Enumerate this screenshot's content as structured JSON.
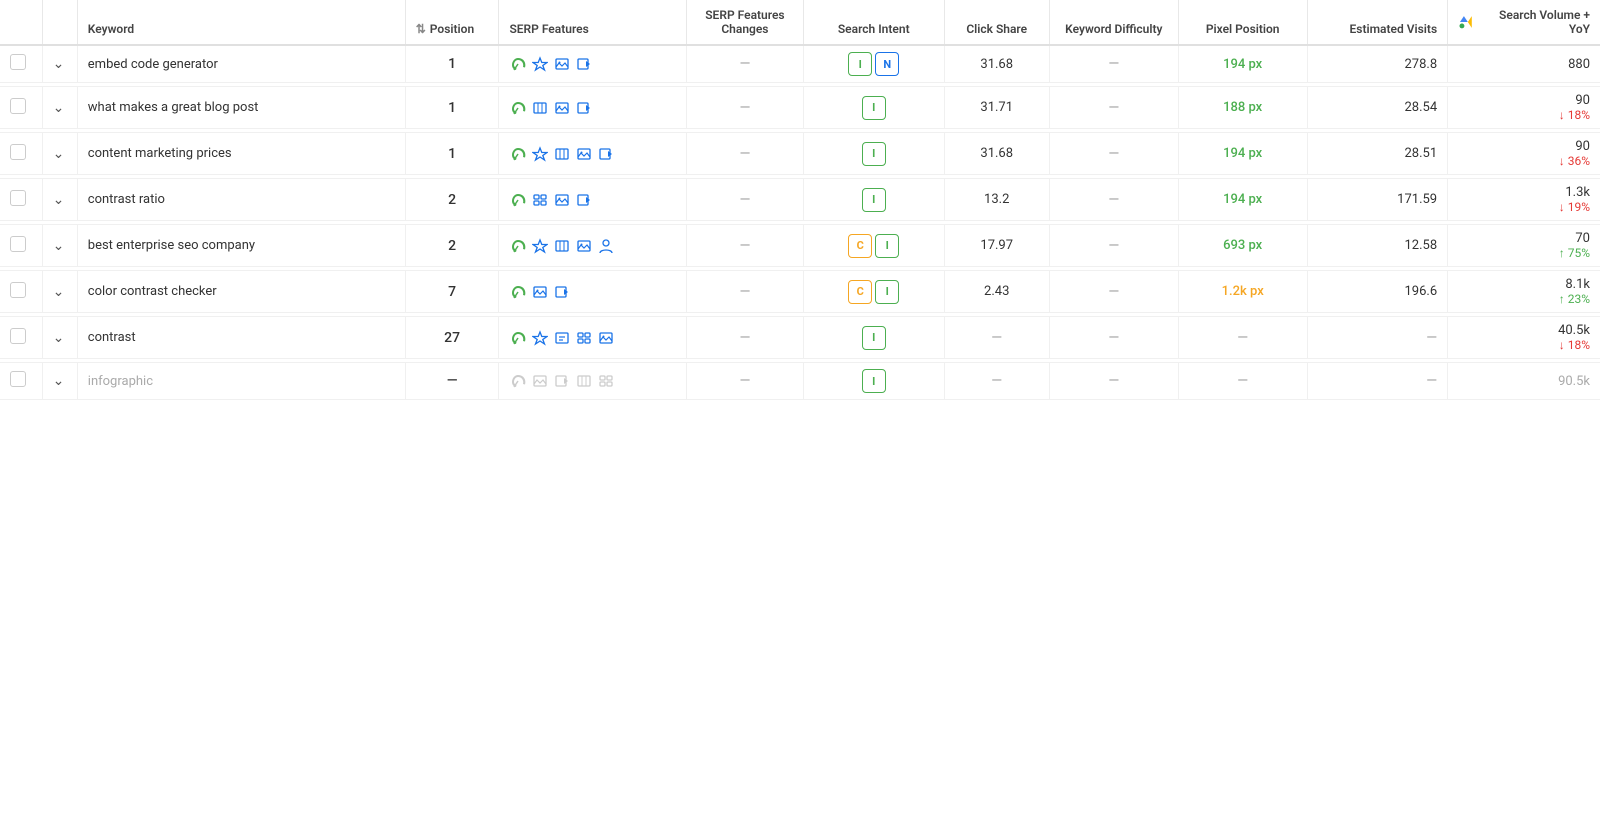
{
  "header": {
    "col_check": "",
    "col_expand": "",
    "col_keyword": "Keyword",
    "col_position": "Position",
    "col_serp": "SERP Features",
    "col_serp_changes": "SERP Features Changes",
    "col_intent": "Search Intent",
    "col_click": "Click Share",
    "col_kd": "Keyword Difficulty",
    "col_pixel": "Pixel Position",
    "col_visits": "Estimated Visits",
    "col_volume": "Search Volume + YoY"
  },
  "rows": [
    {
      "id": 1,
      "keyword": "embed code generator",
      "muted": false,
      "position": "1",
      "serp_icons": [
        "leaf",
        "star",
        "image",
        "video"
      ],
      "serp_changes": "—",
      "intents": [
        "I",
        "N"
      ],
      "click_share": "31.68",
      "kd": "—",
      "pixel": "194 px",
      "pixel_color": "green",
      "visits": "278.8",
      "volume": "880",
      "yoy": "",
      "yoy_dir": ""
    },
    {
      "id": 2,
      "keyword": "what makes a great blog post",
      "muted": false,
      "position": "1",
      "serp_icons": [
        "leaf",
        "image2",
        "image",
        "video"
      ],
      "serp_changes": "—",
      "intents": [
        "I"
      ],
      "click_share": "31.71",
      "kd": "—",
      "pixel": "188 px",
      "pixel_color": "green",
      "visits": "28.54",
      "volume": "90",
      "yoy": "18%",
      "yoy_dir": "down"
    },
    {
      "id": 3,
      "keyword": "content marketing prices",
      "muted": false,
      "position": "1",
      "serp_icons": [
        "leaf",
        "star",
        "image2",
        "image",
        "video"
      ],
      "serp_changes": "—",
      "intents": [
        "I"
      ],
      "click_share": "31.68",
      "kd": "—",
      "pixel": "194 px",
      "pixel_color": "green",
      "visits": "28.51",
      "volume": "90",
      "yoy": "36%",
      "yoy_dir": "down"
    },
    {
      "id": 4,
      "keyword": "contrast ratio",
      "muted": false,
      "position": "2",
      "serp_icons": [
        "leaf",
        "sitelinks",
        "image",
        "video"
      ],
      "serp_changes": "—",
      "intents": [
        "I"
      ],
      "click_share": "13.2",
      "kd": "—",
      "pixel": "194 px",
      "pixel_color": "green",
      "visits": "171.59",
      "volume": "1.3k",
      "yoy": "19%",
      "yoy_dir": "down"
    },
    {
      "id": 5,
      "keyword": "best enterprise seo company",
      "muted": false,
      "position": "2",
      "serp_icons": [
        "leaf",
        "star",
        "image2",
        "image",
        "person"
      ],
      "serp_changes": "—",
      "intents": [
        "C",
        "I"
      ],
      "click_share": "17.97",
      "kd": "—",
      "pixel": "693 px",
      "pixel_color": "green",
      "visits": "12.58",
      "volume": "70",
      "yoy": "75%",
      "yoy_dir": "up"
    },
    {
      "id": 6,
      "keyword": "color contrast checker",
      "muted": false,
      "position": "7",
      "serp_icons": [
        "leaf",
        "image",
        "video"
      ],
      "serp_changes": "—",
      "intents": [
        "C",
        "I"
      ],
      "click_share": "2.43",
      "kd": "—",
      "pixel": "1.2k px",
      "pixel_color": "orange",
      "visits": "196.6",
      "volume": "8.1k",
      "yoy": "23%",
      "yoy_dir": "up"
    },
    {
      "id": 7,
      "keyword": "contrast",
      "muted": false,
      "position": "27",
      "serp_icons": [
        "leaf",
        "star",
        "special",
        "sitelinks",
        "image"
      ],
      "serp_changes": "—",
      "intents": [
        "I"
      ],
      "click_share": "—",
      "kd": "—",
      "pixel": "—",
      "pixel_color": "",
      "visits": "—",
      "volume": "40.5k",
      "yoy": "18%",
      "yoy_dir": "down"
    },
    {
      "id": 8,
      "keyword": "infographic",
      "muted": true,
      "position": "—",
      "serp_icons": [
        "leaf-m",
        "image-m",
        "video-m",
        "image2-m",
        "sitelinks-m"
      ],
      "serp_changes": "—",
      "intents": [
        "I"
      ],
      "click_share": "—",
      "kd": "—",
      "pixel": "—",
      "pixel_color": "",
      "visits": "—",
      "volume": "90.5k",
      "yoy": "",
      "yoy_dir": ""
    }
  ]
}
